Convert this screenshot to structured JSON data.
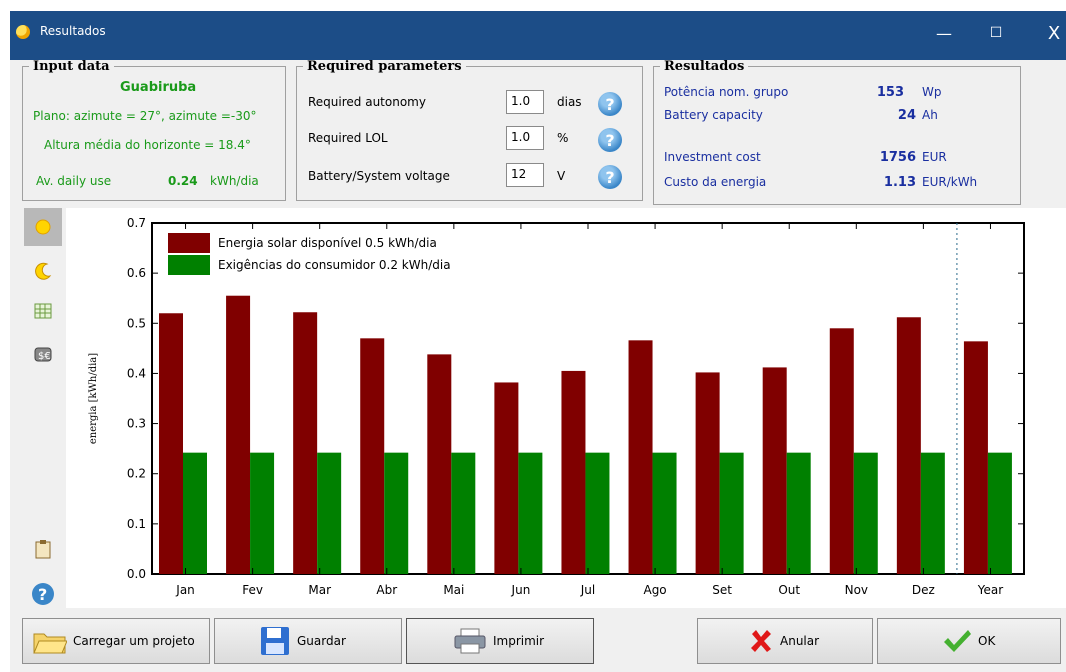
{
  "window": {
    "title": "Resultados",
    "minimize": "—",
    "maximize": "☐",
    "close": "X"
  },
  "input_data": {
    "legend": "Input data",
    "site": "Guabiruba",
    "plane": "Plano: azimute = 27°, azimute =-30°",
    "horizon": "Altura média do horizonte = 18.4°",
    "daily_use_label": "Av. daily use",
    "daily_use_value": "0.24",
    "daily_use_unit": "kWh/dia"
  },
  "required": {
    "legend": "Required parameters",
    "rows": [
      {
        "label": "Required autonomy",
        "value": "1.0",
        "unit": "dias"
      },
      {
        "label": "Required LOL",
        "value": "1.0",
        "unit": "%"
      },
      {
        "label": "Battery/System voltage",
        "value": "12",
        "unit": "V"
      }
    ]
  },
  "results": {
    "legend": "Resultados",
    "rows": [
      {
        "label": "Potência nom. grupo",
        "value": "153",
        "unit": "Wp"
      },
      {
        "label": "Battery capacity",
        "value": "24",
        "unit": "Ah"
      },
      {
        "label": "Investment cost",
        "value": "1756",
        "unit": "EUR"
      },
      {
        "label": "Custo da energia",
        "value": "1.13",
        "unit": "EUR/kWh"
      }
    ]
  },
  "buttons": {
    "load": "Carregar um projeto",
    "save": "Guardar",
    "print": "Imprimir",
    "cancel": "Anular",
    "ok": "OK"
  },
  "sidebar_icons": [
    "sun-icon",
    "moon-icon",
    "table-icon",
    "money-bag-icon",
    "clipboard-icon",
    "help-icon"
  ],
  "chart_data": {
    "type": "bar",
    "ylabel": "energia [kWh/dia]",
    "ylim": [
      0,
      0.7
    ],
    "yticks": [
      "0.0",
      "0.1",
      "0.2",
      "0.3",
      "0.4",
      "0.5",
      "0.6",
      "0.7"
    ],
    "categories": [
      "Jan",
      "Fev",
      "Mar",
      "Abr",
      "Mai",
      "Jun",
      "Jul",
      "Ago",
      "Set",
      "Out",
      "Nov",
      "Dez",
      "Year"
    ],
    "series": [
      {
        "name": "Energia solar disponível",
        "legend_value": "0.5 kWh/dia",
        "color": "#800000",
        "values": [
          0.52,
          0.555,
          0.522,
          0.47,
          0.438,
          0.382,
          0.405,
          0.466,
          0.402,
          0.412,
          0.49,
          0.512,
          0.464
        ]
      },
      {
        "name": "Exigências do consumidor",
        "legend_value": "0.2 kWh/dia",
        "color": "#008000",
        "values": [
          0.242,
          0.242,
          0.242,
          0.242,
          0.242,
          0.242,
          0.242,
          0.242,
          0.242,
          0.242,
          0.242,
          0.242,
          0.242
        ]
      }
    ],
    "legend": "top-left",
    "grid": false
  }
}
